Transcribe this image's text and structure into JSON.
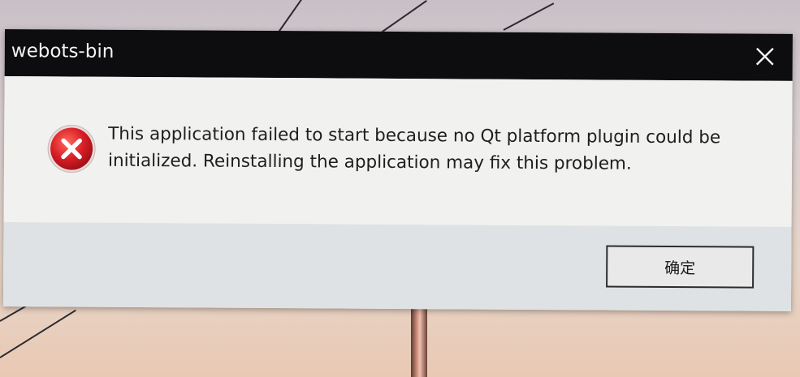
{
  "window": {
    "title": "webots-bin",
    "close_icon": "close-icon"
  },
  "dialog": {
    "icon": "error-icon",
    "message_line1": "This application failed to start because no Qt platform plugin could be",
    "message_line2": "initialized. Reinstalling the application may fix this problem.",
    "ok_label": "确定"
  },
  "colors": {
    "titlebar": "#0d0d0f",
    "error_red": "#d81e26",
    "dialog_bg": "#f1f1ef",
    "button_area_bg": "#dfe2e5"
  }
}
